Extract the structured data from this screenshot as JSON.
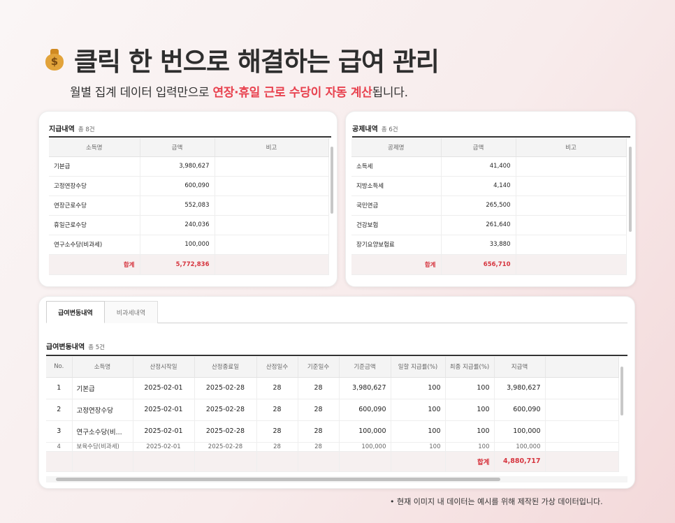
{
  "heading": {
    "icon": "money-bag-icon",
    "icon_glyph": "$",
    "title": "클릭 한 번으로 해결하는 급여 관리"
  },
  "subtitle": {
    "prefix": "월별 집계 데이터 입력만으로 ",
    "highlight": "연장·휴일 근로 수당이 자동 계산",
    "suffix": "됩니다."
  },
  "pay_panel": {
    "title": "지급내역",
    "count": "총 8건",
    "headers": [
      "소득명",
      "금액",
      "비고"
    ],
    "rows": [
      {
        "name": "기본급",
        "amount": "3,980,627",
        "note": ""
      },
      {
        "name": "고정연장수당",
        "amount": "600,090",
        "note": ""
      },
      {
        "name": "연장근로수당",
        "amount": "552,083",
        "note": ""
      },
      {
        "name": "휴일근로수당",
        "amount": "240,036",
        "note": ""
      },
      {
        "name": "연구소수당(비과세)",
        "amount": "100,000",
        "note": ""
      }
    ],
    "total_label": "합계",
    "total": "5,772,836"
  },
  "deduct_panel": {
    "title": "공제내역",
    "count": "총 6건",
    "headers": [
      "공제명",
      "금액",
      "비고"
    ],
    "rows": [
      {
        "name": "소득세",
        "amount": "41,400",
        "note": ""
      },
      {
        "name": "지방소득세",
        "amount": "4,140",
        "note": ""
      },
      {
        "name": "국민연금",
        "amount": "265,500",
        "note": ""
      },
      {
        "name": "건강보험",
        "amount": "261,640",
        "note": ""
      },
      {
        "name": "장기요양보험료",
        "amount": "33,880",
        "note": ""
      }
    ],
    "total_label": "합계",
    "total": "656,710"
  },
  "change_panel": {
    "tabs": [
      "급여변동내역",
      "비과세내역"
    ],
    "title": "급여변동내역",
    "count": "총 5건",
    "headers": [
      "No.",
      "소득명",
      "산정시작일",
      "산정종료일",
      "산정일수",
      "기준일수",
      "기준금액",
      "일할 지급률(%)",
      "최종 지급률(%)",
      "지급액"
    ],
    "rows": [
      [
        "1",
        "기본급",
        "2025-02-01",
        "2025-02-28",
        "28",
        "28",
        "3,980,627",
        "100",
        "100",
        "3,980,627"
      ],
      [
        "2",
        "고정연장수당",
        "2025-02-01",
        "2025-02-28",
        "28",
        "28",
        "600,090",
        "100",
        "100",
        "600,090"
      ],
      [
        "3",
        "연구소수당(비...",
        "2025-02-01",
        "2025-02-28",
        "28",
        "28",
        "100,000",
        "100",
        "100",
        "100,000"
      ]
    ],
    "partial_row": [
      "4",
      "보육수당(비과세)",
      "2025-02-01",
      "2025-02-28",
      "28",
      "28",
      "100,000",
      "100",
      "100",
      "100,000"
    ],
    "total_label": "합계",
    "total": "4,880,717"
  },
  "footnote": "• 현재 이미지 내 데이터는 예시를 위해 제작된 가상 데이터입니다.",
  "colors": {
    "accent": "#e8424f",
    "sum_text": "#d6343e",
    "sum_bg": "#f6f0f0"
  }
}
